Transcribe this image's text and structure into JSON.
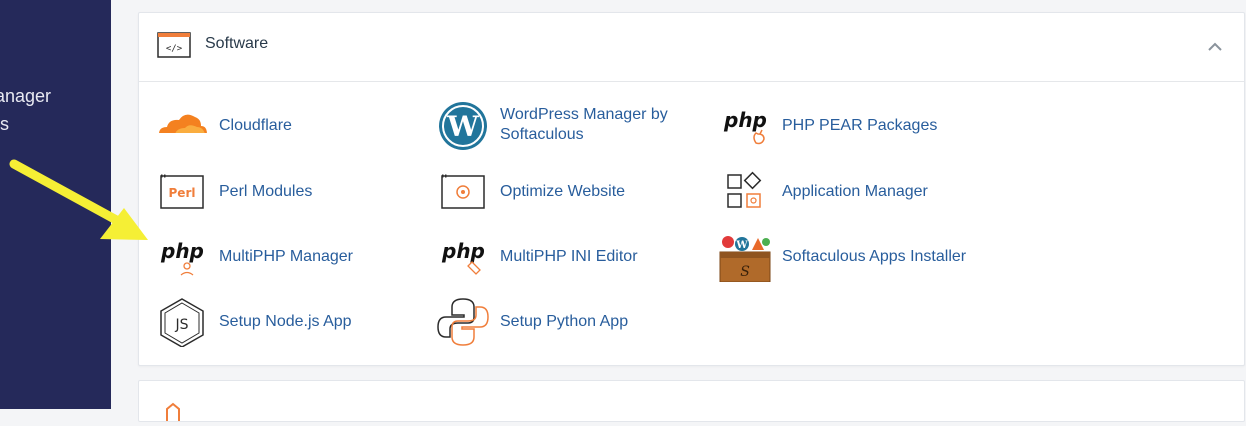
{
  "sidebar": {
    "items": [
      {
        "label": "Manager"
      },
      {
        "label": "ous"
      }
    ]
  },
  "section": {
    "title": "Software",
    "apps": [
      {
        "label": "Cloudflare",
        "icon": "cloudflare-icon"
      },
      {
        "label": "WordPress Manager by Softaculous",
        "icon": "wordpress-icon"
      },
      {
        "label": "PHP PEAR Packages",
        "icon": "php-pear-icon"
      },
      {
        "label": "Perl Modules",
        "icon": "perl-icon"
      },
      {
        "label": "Optimize Website",
        "icon": "optimize-icon"
      },
      {
        "label": "Application Manager",
        "icon": "app-manager-icon"
      },
      {
        "label": "MultiPHP Manager",
        "icon": "php-manager-icon"
      },
      {
        "label": "MultiPHP INI Editor",
        "icon": "php-ini-icon"
      },
      {
        "label": "Softaculous Apps Installer",
        "icon": "softaculous-icon"
      },
      {
        "label": "Setup Node.js App",
        "icon": "nodejs-icon"
      },
      {
        "label": "Setup Python App",
        "icon": "python-icon"
      }
    ]
  },
  "colors": {
    "sidebar_bg": "#25295a",
    "link": "#285d9c",
    "accent_orange": "#f07e3b",
    "arrow_yellow": "#f5ef35"
  }
}
